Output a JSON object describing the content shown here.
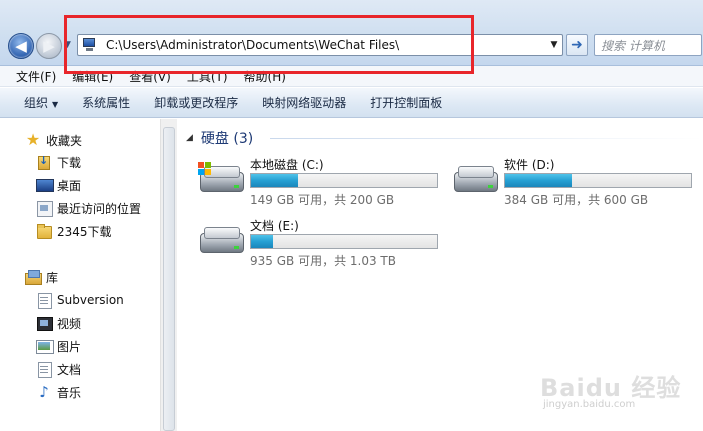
{
  "address_bar": {
    "path": "C:\\Users\\Administrator\\Documents\\WeChat Files\\",
    "search_placeholder": "搜索 计算机"
  },
  "menu": [
    "文件(F)",
    "编辑(E)",
    "查看(V)",
    "工具(T)",
    "帮助(H)"
  ],
  "toolbar": {
    "organize": "组织",
    "system_properties": "系统属性",
    "uninstall": "卸载或更改程序",
    "map_drive": "映射网络驱动器",
    "control_panel": "打开控制面板"
  },
  "sidebar": {
    "favorites": {
      "label": "收藏夹",
      "items": [
        "下载",
        "桌面",
        "最近访问的位置",
        "2345下载"
      ]
    },
    "libraries": {
      "label": "库",
      "items": [
        "Subversion",
        "视频",
        "图片",
        "文档",
        "音乐"
      ]
    }
  },
  "content": {
    "group_title": "硬盘 (3)",
    "drives": [
      {
        "name": "本地磁盘 (C:)",
        "info": "149 GB 可用，共 200 GB",
        "used_fraction": 0.255
      },
      {
        "name": "软件 (D:)",
        "info": "384 GB 可用，共 600 GB",
        "used_fraction": 0.36
      },
      {
        "name": "文档 (E:)",
        "info": "935 GB 可用，共 1.03 TB",
        "used_fraction": 0.12
      }
    ]
  },
  "watermark": {
    "text": "Baidu 经验",
    "url": "jingyan.baidu.com"
  },
  "colors": {
    "highlight_frame": "#e8262b",
    "progress_fill": "#26a0d3"
  }
}
